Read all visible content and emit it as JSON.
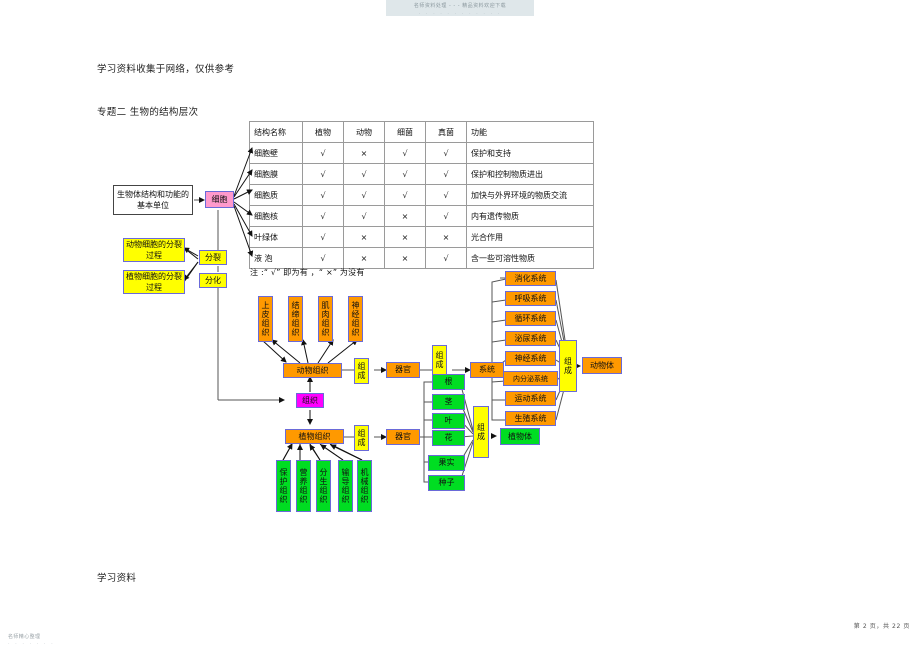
{
  "document": {
    "top_watermark_line1": "名师资料处理 - - - 精品资料欢迎下载",
    "top_watermark_line2": "· · · · · · · · · · · ·",
    "note": "学习资料收集于网络，仅供参考",
    "title": "专题二  生物的结构层次",
    "footer": "学习资料",
    "bottom_watermark": "名师精心整理",
    "bottom_watermark_dots": "· · · · · · ·",
    "page_number": "第 2 页，共 22 页"
  },
  "table": {
    "headers": [
      "结构名称",
      "植物",
      "动物",
      "细菌",
      "真菌",
      "功能"
    ],
    "rows": [
      {
        "name": "细胞壁",
        "plant": "√",
        "animal": "×",
        "bacteria": "√",
        "fungi": "√",
        "function": "保护和支持"
      },
      {
        "name": "细胞膜",
        "plant": "√",
        "animal": "√",
        "bacteria": "√",
        "fungi": "√",
        "function": "保护和控制物质进出"
      },
      {
        "name": "细胞质",
        "plant": "√",
        "animal": "√",
        "bacteria": "√",
        "fungi": "√",
        "function": "加快与外界环境的物质交流"
      },
      {
        "name": "细胞核",
        "plant": "√",
        "animal": "√",
        "bacteria": "×",
        "fungi": "√",
        "function": "内有遗传物质"
      },
      {
        "name": "叶绿体",
        "plant": "√",
        "animal": "×",
        "bacteria": "×",
        "fungi": "×",
        "function": "光合作用"
      },
      {
        "name": "液  泡",
        "plant": "√",
        "animal": "×",
        "bacteria": "×",
        "fungi": "√",
        "function": "含一些可溶性物质"
      }
    ],
    "note": "注 :“ √” 即为有 ，“ ×” 为没有"
  },
  "diagram": {
    "definition_box": "生物体结构和功能的基本单位",
    "cell": "细胞",
    "division": "分裂",
    "differentiation": "分化",
    "animal_cell_division": "动物细胞的分裂过程",
    "plant_cell_division": "植物细胞的分裂过程",
    "tissue": "组织",
    "animal_tissue": "动物组织",
    "plant_tissue": "植物组织",
    "animal_tissues": [
      "上皮组织",
      "结缔组织",
      "肌肉组织",
      "神经组织"
    ],
    "plant_tissues": [
      "保护组织",
      "营养组织",
      "分生组织",
      "输导组织",
      "机械组织"
    ],
    "compose_label": "组成",
    "organ": "器官",
    "system": "系统",
    "plant_organs": [
      "根",
      "茎",
      "叶",
      "花",
      "果实",
      "种子"
    ],
    "animal_systems": [
      "消化系统",
      "呼吸系统",
      "循环系统",
      "泌尿系统",
      "神经系统",
      "内分泌系统",
      "运动系统",
      "生殖系统"
    ],
    "animal_body": "动物体",
    "plant_body": "植物体"
  },
  "colors": {
    "yellow": "#ffff00",
    "orange": "#ff9900",
    "green": "#00dd22",
    "magenta": "#ff00ff",
    "pink": "#ff99cc",
    "border": "#6a6ad8"
  }
}
